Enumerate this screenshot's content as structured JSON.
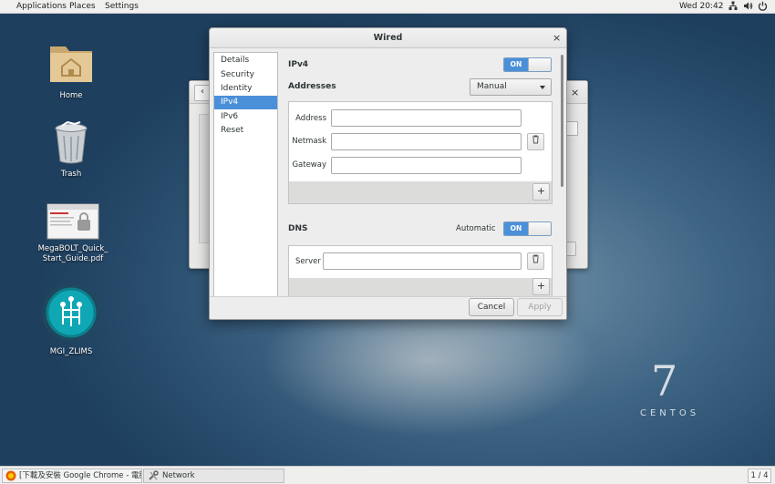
{
  "topbar": {
    "menus": [
      "Applications",
      "Places",
      "Settings"
    ],
    "clock": "Wed 20:42",
    "icons": [
      "network-icon",
      "volume-icon",
      "power-icon"
    ]
  },
  "desktop": {
    "icons": [
      {
        "label": "Home",
        "icon": "folder-home-icon"
      },
      {
        "label": "Trash",
        "icon": "trash-icon"
      },
      {
        "label_line1": "MegaBOLT_Quick_",
        "label_line2": "Start_Guide.pdf",
        "icon": "pdf-document-icon"
      },
      {
        "label": "MGI_ZLIMS",
        "icon": "zlims-app-icon"
      }
    ],
    "branding": {
      "number": "7",
      "text": "CENTOS"
    }
  },
  "dialog": {
    "title": "Wired",
    "sidebar": [
      {
        "label": "Details",
        "selected": false
      },
      {
        "label": "Security",
        "selected": false
      },
      {
        "label": "Identity",
        "selected": false
      },
      {
        "label": "IPv4",
        "selected": true
      },
      {
        "label": "IPv6",
        "selected": false
      },
      {
        "label": "Reset",
        "selected": false
      }
    ],
    "ipv4": {
      "heading": "IPv4",
      "switch_label": "ON",
      "addresses_label": "Addresses",
      "method": "Manual",
      "fields": {
        "address": {
          "label": "Address",
          "value": ""
        },
        "netmask": {
          "label": "Netmask",
          "value": ""
        },
        "gateway": {
          "label": "Gateway",
          "value": ""
        }
      },
      "add_label": "+"
    },
    "dns": {
      "heading": "DNS",
      "automatic_label": "Automatic",
      "switch_label": "ON",
      "server_label": "Server",
      "server_value": "",
      "add_label": "+"
    },
    "buttons": {
      "cancel": "Cancel",
      "apply": "Apply"
    }
  },
  "taskbar": {
    "tasks": [
      {
        "label": "[下載及安裝 Google Chrome - 電腦 ...",
        "icon": "firefox-icon"
      },
      {
        "label": "Network",
        "icon": "network-tools-icon"
      }
    ],
    "workspace": "1 / 4"
  },
  "colors": {
    "accent": "#4a90d9",
    "desktop": "#3f6585"
  }
}
